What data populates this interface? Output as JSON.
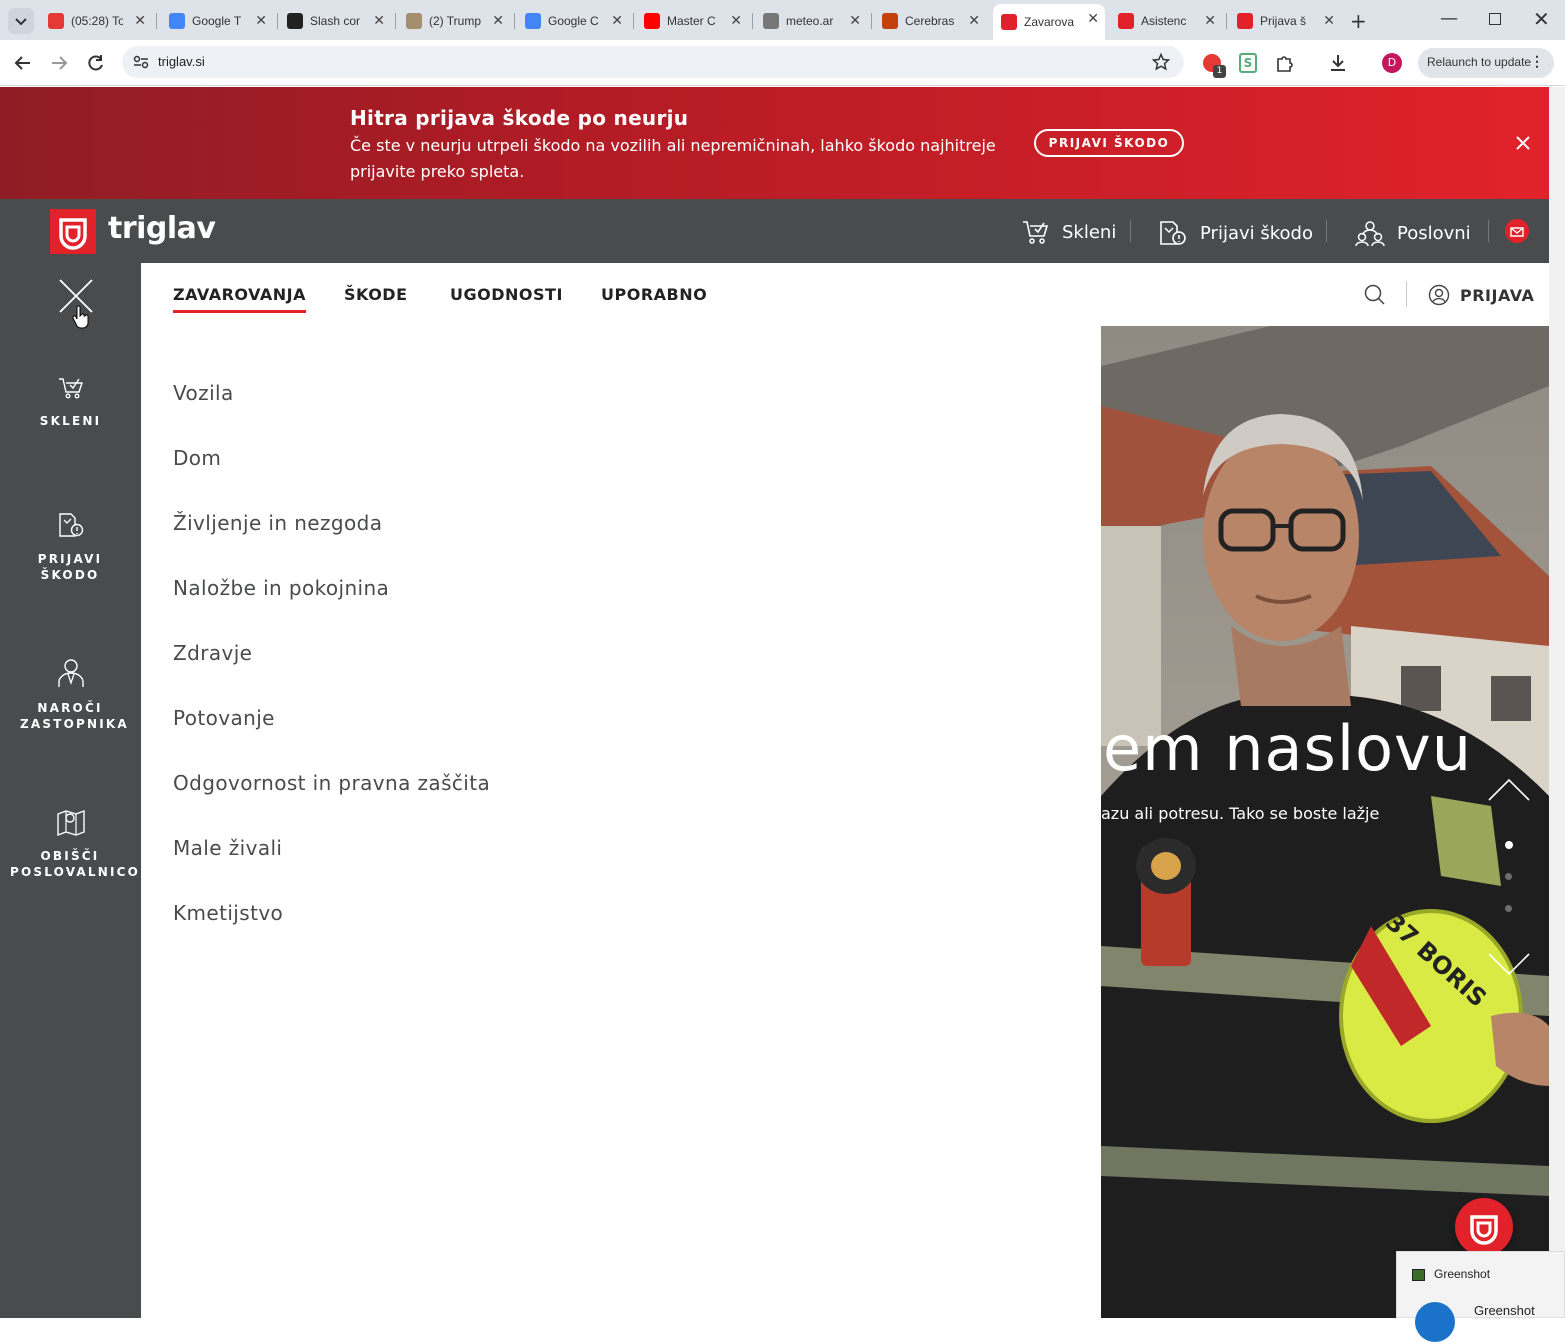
{
  "browser": {
    "tabs": [
      {
        "title": "(05:28) To",
        "favicon_color": "#e53935"
      },
      {
        "title": "Google T",
        "favicon_color": "#4285f4"
      },
      {
        "title": "Slash cor",
        "favicon_color": "#222222"
      },
      {
        "title": "(2) Trump",
        "favicon_color": "#a58d6f"
      },
      {
        "title": "Google C",
        "favicon_color": "#4285f4"
      },
      {
        "title": "Master C",
        "favicon_color": "#ff0000"
      },
      {
        "title": "meteo.ar",
        "favicon_color": "#777777"
      },
      {
        "title": "Cerebras",
        "favicon_color": "#c2410c"
      },
      {
        "title": "Zavarova",
        "favicon_color": "#e1222b"
      },
      {
        "title": "Asistenc",
        "favicon_color": "#e1222b"
      },
      {
        "title": "Prijava š",
        "favicon_color": "#e1222b"
      }
    ],
    "active_tab_index": 8,
    "url": "triglav.si",
    "profile_initial": "D",
    "relaunch_label": "Relaunch to update",
    "extension_badge": "1"
  },
  "banner": {
    "title": "Hitra prijava škode po neurju",
    "text": "Če ste v neurju utrpeli škodo na vozilih ali nepremičninah, lahko škodo najhitreje prijavite preko spleta.",
    "button_label": "PRIJAVI ŠKODO"
  },
  "header": {
    "logo_text": "triglav",
    "nav": [
      {
        "label": "Skleni",
        "icon": "cart-check-icon"
      },
      {
        "label": "Prijavi škodo",
        "icon": "claim-icon"
      },
      {
        "label": "Poslovni",
        "icon": "business-people-icon"
      }
    ]
  },
  "sidebar": {
    "items": [
      {
        "label": "SKLENI",
        "icon": "cart-check-icon"
      },
      {
        "label": "PRIJAVI ŠKODO",
        "icon": "claim-icon"
      },
      {
        "label": "NAROČI ZASTOPNIKA",
        "icon": "agent-icon"
      },
      {
        "label": "OBIŠČI POSLOVALNICO",
        "icon": "map-pin-icon"
      }
    ]
  },
  "menu": {
    "tabs": [
      "ZAVAROVANJA",
      "ŠKODE",
      "UGODNOSTI",
      "UPORABNO"
    ],
    "active_tab": "ZAVAROVANJA",
    "login_label": "PRIJAVA",
    "items": [
      "Vozila",
      "Dom",
      "Življenje in nezgoda",
      "Naložbe in pokojnina",
      "Zdravje",
      "Potovanje",
      "Odgovornost in pravna zaščita",
      "Male živali",
      "Kmetijstvo"
    ]
  },
  "hero": {
    "heading": "em naslovu",
    "subtext": "azu ali potresu. Tako se boste lažje",
    "helmet_text": "37 BORIS"
  },
  "notification": {
    "app": "Greenshot",
    "title": "Greenshot"
  },
  "colors": {
    "brand_red": "#e1222b",
    "dark_gray": "#4a4b4d"
  }
}
